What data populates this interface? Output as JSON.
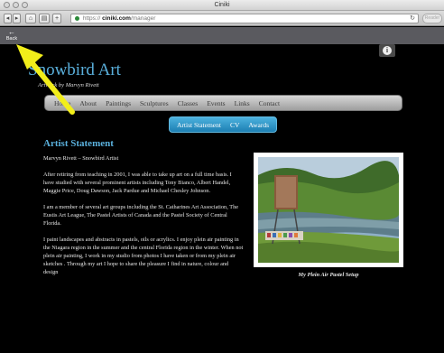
{
  "browser": {
    "window_title": "Ciniki",
    "url_host": "ciniki.com",
    "url_path": "/manager",
    "url_scheme": "https",
    "reload_icon": "reload-icon",
    "reader_label": "Reader"
  },
  "appbar": {
    "back_arrow": "←",
    "back_label": "Back"
  },
  "site": {
    "title": "Snowbird Art",
    "tagline": "Artwork by Marvyn Rivett",
    "info_glyph": "i",
    "nav": [
      "Home",
      "About",
      "Paintings",
      "Sculptures",
      "Classes",
      "Events",
      "Links",
      "Contact"
    ],
    "subnav": [
      "Artist Statement",
      "CV",
      "Awards"
    ],
    "heading": "Artist Statement",
    "paragraphs": [
      "Marvyn Rivett – Snowbird Artist",
      "After retiring from teaching in 2001, I was able to take up art on a full time basis. I have studied with several prominent artists including Tony Bianco, Albert Handel, Maggie Price, Doug Dawson, Jack Pardue and Michael Chesley Johnson.",
      "I am a member of several art groups including the St. Catharines Art Association, The Eustis Art League, The Pastel Artists of Canada and the Pastel Society of Central Florida.",
      "I paint landscapes and abstracts in pastels, oils or acrylics. I enjoy plein air painting in the Niagara region in the summer and the central Florida region in the winter. When not plein air painting, I work in my studio from photos I have taken or from my plein air sketches . Through my art I hope to share the pleasure I find in nature, colour and design"
    ],
    "photo_caption": "My Plein Air Pastel Setup"
  },
  "colors": {
    "accent": "#5ab0dc",
    "annotation_arrow": "#f2ee1a",
    "appbar": "#5a5a5f"
  }
}
